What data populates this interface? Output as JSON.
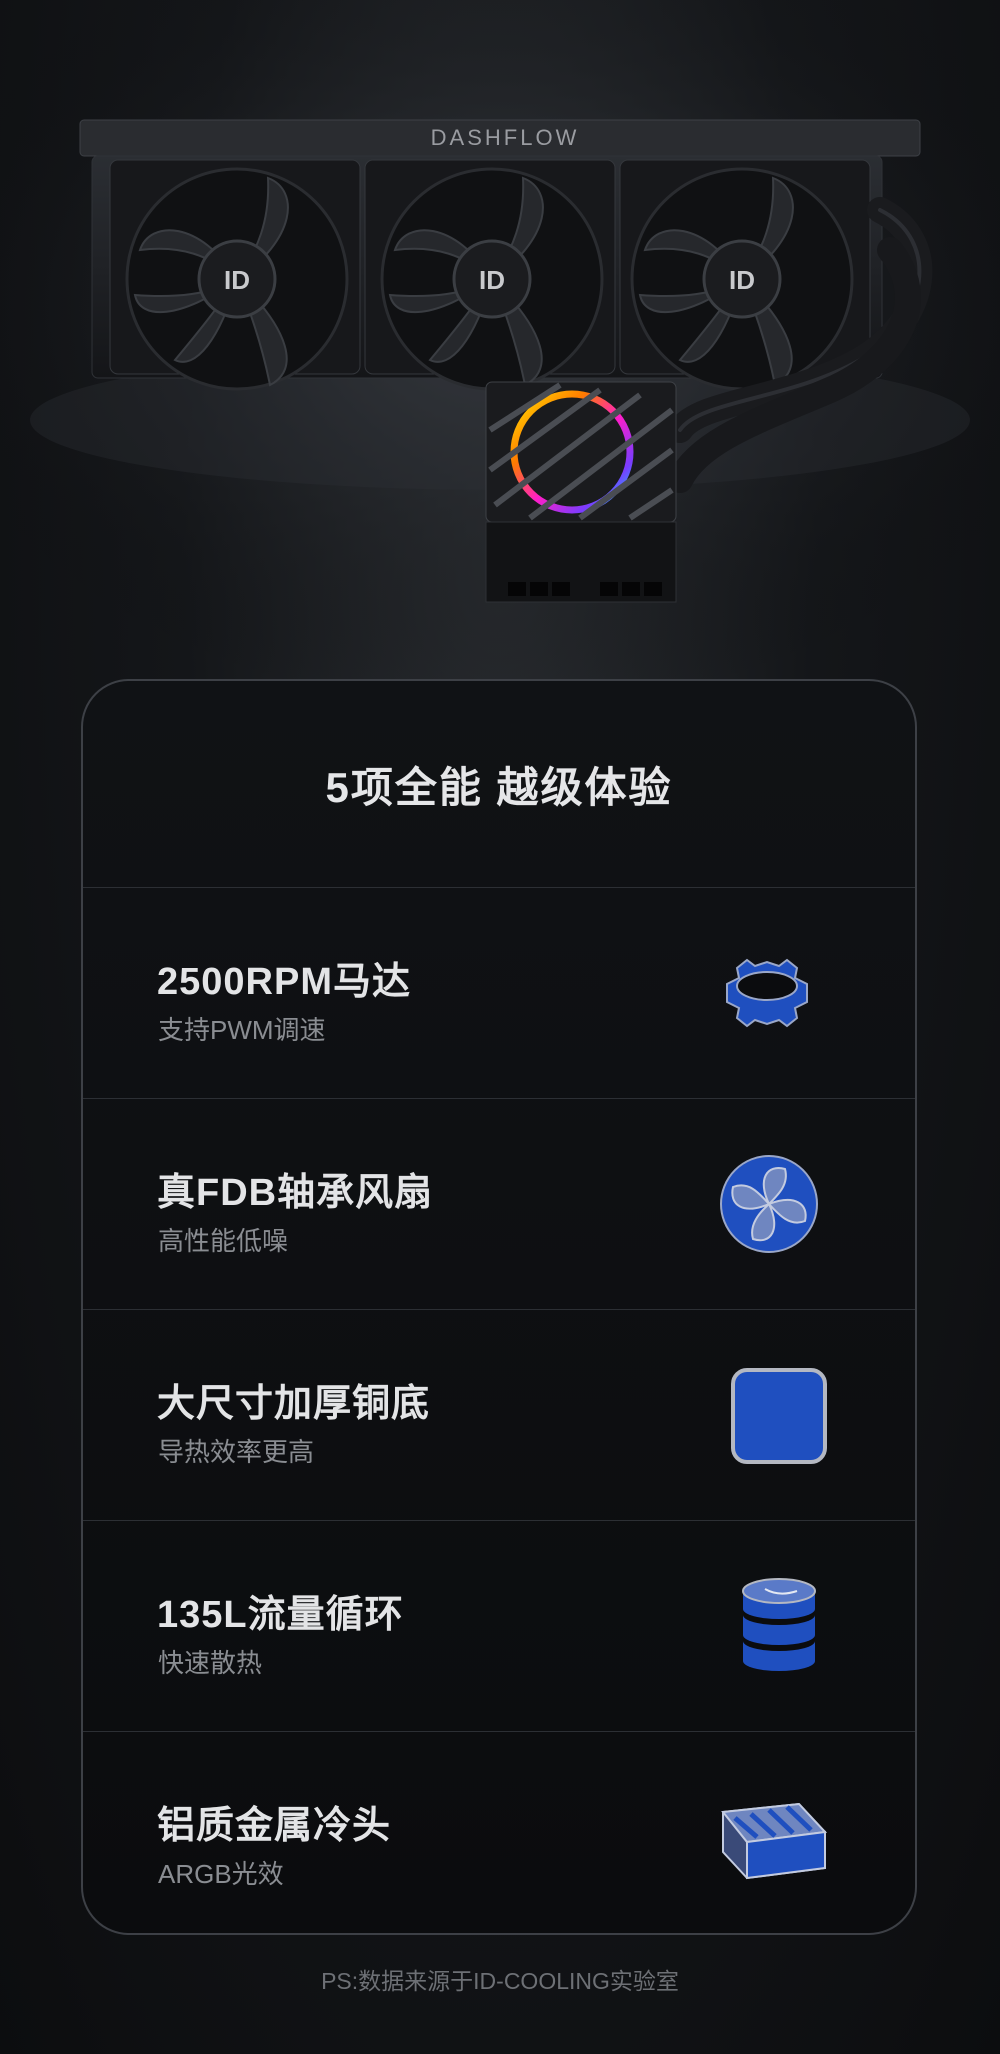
{
  "product": {
    "brand_logo": "DASHFLOW",
    "image_alt": "liquid-cooler-product-image"
  },
  "card": {
    "title": "5项全能 越级体验",
    "features": [
      {
        "title": "2500RPM马达",
        "subtitle": "支持PWM调速",
        "icon": "motor-gear-icon"
      },
      {
        "title": "真FDB轴承风扇",
        "subtitle": "高性能低噪",
        "icon": "fan-icon"
      },
      {
        "title": "大尺寸加厚铜底",
        "subtitle": "导热效率更高",
        "icon": "copper-base-icon"
      },
      {
        "title": "135L流量循环",
        "subtitle": "快速散热",
        "icon": "flow-cylinder-icon"
      },
      {
        "title": "铝质金属冷头",
        "subtitle": "ARGB光效",
        "icon": "aluminum-pump-head-icon"
      }
    ]
  },
  "footnote": "PS:数据来源于ID-COOLING实验室",
  "colors": {
    "icon_blue": "#1f4fbf",
    "icon_outline": "#9aa7c8",
    "card_border": "#3d4046",
    "background": "#0c0d0f"
  }
}
